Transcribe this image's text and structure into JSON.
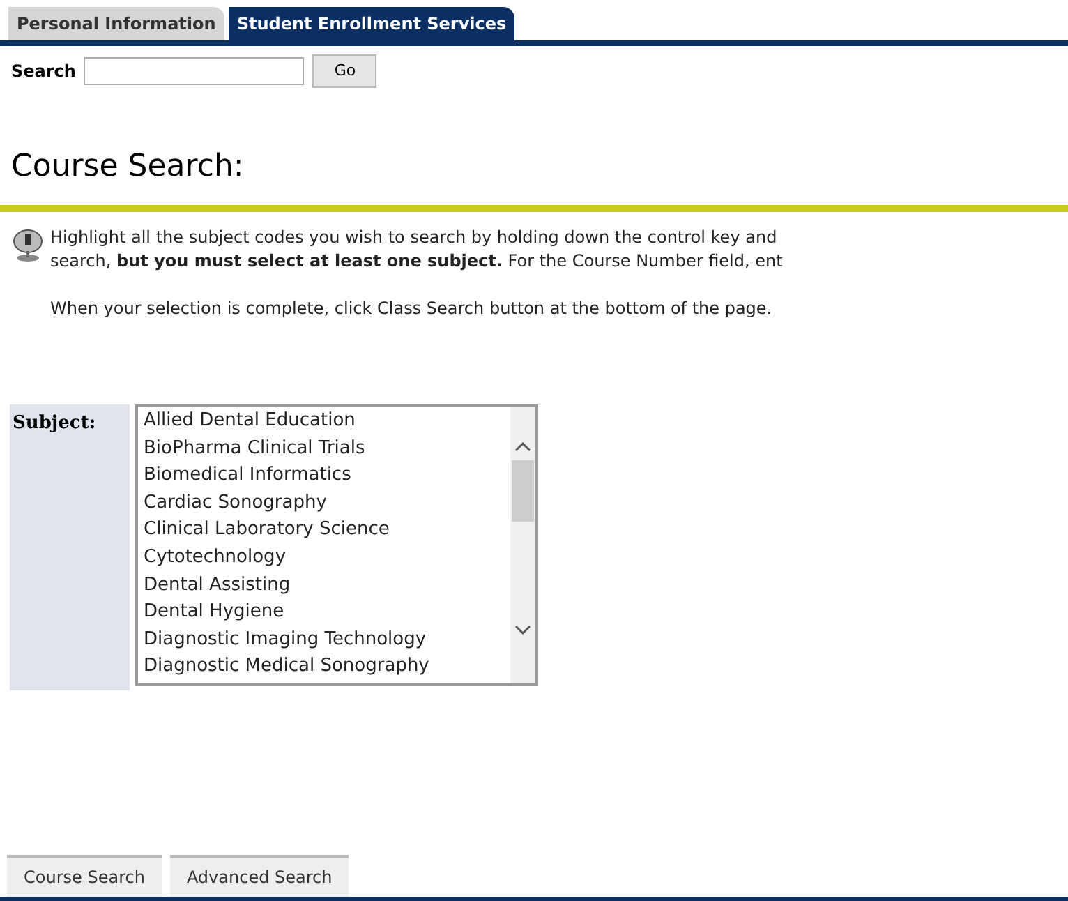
{
  "tabs": [
    {
      "label": "Personal Information",
      "selected": false
    },
    {
      "label": "Student Enrollment Services",
      "selected": true
    }
  ],
  "search": {
    "label": "Search",
    "button": "Go"
  },
  "title": "Course Search:",
  "info": {
    "lines": [
      "Highlight all the subject codes you wish to search by holding down the control key and",
      "search, **but you must select at least one subject.** For the Course Number field, ent"
    ],
    "note": "When your selection is complete, click Class Search button at the bottom of the page."
  },
  "subject": {
    "label": "Subject:",
    "options": [
      "Allied Dental Education",
      "BioPharma Clinical Trials",
      "Biomedical Informatics",
      "Cardiac Sonography",
      "Clinical Laboratory Science",
      "Cytotechnology",
      "Dental Assisting",
      "Dental Hygiene",
      "Diagnostic Imaging Technology",
      "Diagnostic Medical Sonography"
    ]
  },
  "buttons": [
    "Course Search",
    "Advanced Search"
  ]
}
